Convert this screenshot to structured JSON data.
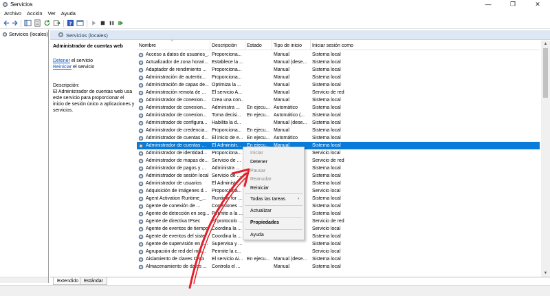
{
  "window": {
    "title": "Servicios",
    "minimize": "—",
    "maximize": "❐",
    "close": "✕"
  },
  "menu": [
    "Archivo",
    "Acción",
    "Ver",
    "Ayuda"
  ],
  "left_pane": {
    "node_label": "Servicios (locales)"
  },
  "header": {
    "label": "Servicios (locales)"
  },
  "details": {
    "title": "Administrador de cuentas web",
    "stop_link": "Detener",
    "stop_suffix": " el servicio",
    "restart_link": "Reiniciar",
    "restart_suffix": " el servicio",
    "description_label": "Descripción:",
    "description_text": "El Administrador de cuentas web usa este servicio para proporcionar el inicio de sesión único a aplicaciones y servicios."
  },
  "columns": [
    "Nombre",
    "Descripción",
    "Estado",
    "Tipo de inicio",
    "Iniciar sesión como"
  ],
  "rows": [
    {
      "name": "Acceso a datos de usuarios_...",
      "desc": "Proporciona...",
      "state": "",
      "start": "Manual",
      "logon": "Sistema local"
    },
    {
      "name": "Actualizador de zona horari...",
      "desc": "Establece la ...",
      "state": "",
      "start": "Manual (dese...",
      "logon": "Sistema local"
    },
    {
      "name": "Adaptador de rendimiento ...",
      "desc": "Proporciona...",
      "state": "",
      "start": "Manual",
      "logon": "Sistema local"
    },
    {
      "name": "Administración de autentic...",
      "desc": "Proporciona...",
      "state": "",
      "start": "Manual",
      "logon": "Sistema local"
    },
    {
      "name": "Administración de capas de...",
      "desc": "Optimiza la ...",
      "state": "",
      "start": "Manual",
      "logon": "Sistema local"
    },
    {
      "name": "Administración remota de ...",
      "desc": "El servicio A...",
      "state": "",
      "start": "Manual",
      "logon": "Servicio de red"
    },
    {
      "name": "Administrador de conexion...",
      "desc": "Crea una con...",
      "state": "",
      "start": "Manual",
      "logon": "Sistema local"
    },
    {
      "name": "Administrador de conexion...",
      "desc": "Administra ...",
      "state": "En ejecu...",
      "start": "Automático",
      "logon": "Sistema local"
    },
    {
      "name": "Administrador de conexion...",
      "desc": "Toma decisi...",
      "state": "En ejecu...",
      "start": "Automático (...",
      "logon": "Sistema local"
    },
    {
      "name": "Administrador de configura...",
      "desc": "Habilita la d...",
      "state": "",
      "start": "Manual (dese...",
      "logon": "Sistema local"
    },
    {
      "name": "Administrador de credencia...",
      "desc": "Proporciona...",
      "state": "En ejecu...",
      "start": "Manual",
      "logon": "Sistema local"
    },
    {
      "name": "Administrador de cuentas d...",
      "desc": "El inicio de e...",
      "state": "En ejecu...",
      "start": "Automático",
      "logon": "Sistema local"
    },
    {
      "name": "Administrador de cuentas ...",
      "desc": "El Administr...",
      "state": "En ejecu...",
      "start": "Manual",
      "logon": "Sistema local"
    },
    {
      "name": "Administrador de identidad...",
      "desc": "Proporciona...",
      "state": "",
      "start": "",
      "logon": "Servicio local"
    },
    {
      "name": "Administrador de mapas de...",
      "desc": "Servicio de ...",
      "state": "",
      "start": "",
      "logon": "Servicio de red"
    },
    {
      "name": "Administrador de pagos y ...",
      "desc": "Administra ...",
      "state": "",
      "start": "",
      "logon": "Sistema local"
    },
    {
      "name": "Administrador de sesión local",
      "desc": "Servicio de ...",
      "state": "",
      "start": "",
      "logon": "Sistema local"
    },
    {
      "name": "Administrador de usuarios",
      "desc": "El Administr...",
      "state": "",
      "start": "",
      "logon": "Sistema local"
    },
    {
      "name": "Adquisición de imágenes d...",
      "desc": "Proporciona...",
      "state": "",
      "start": "",
      "logon": "Servicio local"
    },
    {
      "name": "Agent Activation Runtime_...",
      "desc": "Runtime for ...",
      "state": "",
      "start": "",
      "logon": "Sistema local"
    },
    {
      "name": "Agente de conexión de ...",
      "desc": "Conexiones ...",
      "state": "",
      "start": "",
      "logon": "Sistema local"
    },
    {
      "name": "Agente de detección en seg...",
      "desc": "Permite a la ...",
      "state": "",
      "start": "",
      "logon": "Sistema local"
    },
    {
      "name": "Agente de directiva IPsec",
      "desc": "El protocolo ...",
      "state": "",
      "start": "",
      "logon": "Servicio de red"
    },
    {
      "name": "Agente de eventos de tiempo",
      "desc": "Coordina la ...",
      "state": "",
      "start": "",
      "logon": "Servicio local"
    },
    {
      "name": "Agente de eventos del siste...",
      "desc": "Coordina la ...",
      "state": "",
      "start": "",
      "logon": "Sistema local"
    },
    {
      "name": "Agente de supervisión en ti...",
      "desc": "Supervisa y ...",
      "state": "",
      "start": "",
      "logon": "Sistema local"
    },
    {
      "name": "Agrupación de red del mis...",
      "desc": "Permite la c...",
      "state": "",
      "start": "",
      "logon": "Servicio local"
    },
    {
      "name": "Aislamiento de claves CNG",
      "desc": "El servicio Ai...",
      "state": "En ejecu...",
      "start": "Manual (dese...",
      "logon": "Sistema local"
    },
    {
      "name": "Almacenamiento de datos ...",
      "desc": "Controla el ...",
      "state": "",
      "start": "Manual",
      "logon": "Sistema local"
    }
  ],
  "selected_row": 12,
  "context_menu": [
    {
      "label": "Iniciar",
      "disabled": true
    },
    {
      "label": "Detener",
      "disabled": false
    },
    {
      "label": "Pausar",
      "disabled": true
    },
    {
      "label": "Reanudar",
      "disabled": true
    },
    {
      "label": "Reiniciar",
      "disabled": false
    },
    {
      "label": "Todas las tareas",
      "disabled": false,
      "submenu": true
    },
    {
      "label": "Actualizar",
      "disabled": false
    },
    {
      "label": "Propiedades",
      "disabled": false,
      "bold": true
    },
    {
      "label": "Ayuda",
      "disabled": false
    }
  ],
  "tabs": [
    "Extendido",
    "Estándar"
  ],
  "colors": {
    "selection": "#0a7bd8",
    "annotation_arrow": "#e3202a",
    "link": "#0b57b6"
  }
}
